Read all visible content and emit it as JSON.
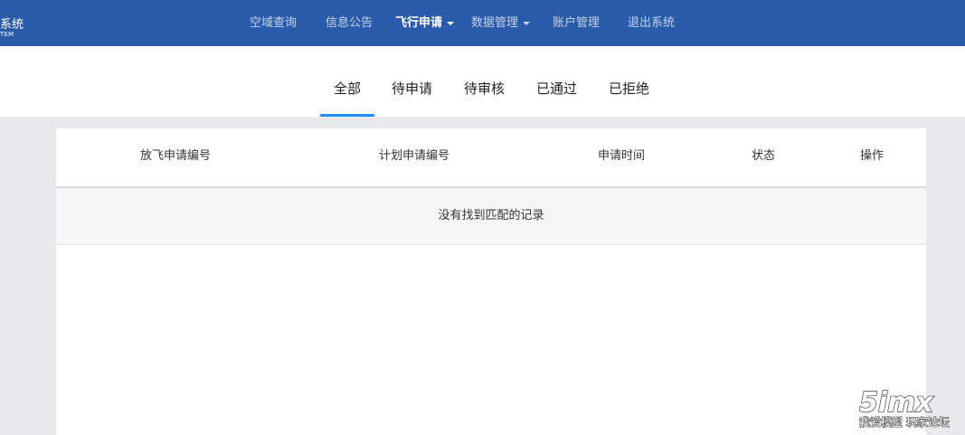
{
  "brand": {
    "title": "系统",
    "subtitle": "TEM"
  },
  "nav": {
    "items": [
      {
        "label": "空域查询"
      },
      {
        "label": "信息公告"
      },
      {
        "label": "飞行申请"
      },
      {
        "label": "数据管理"
      },
      {
        "label": "账户管理"
      },
      {
        "label": "退出系统"
      }
    ],
    "active_index": 2
  },
  "tabs": {
    "items": [
      {
        "label": "全部"
      },
      {
        "label": "待申请"
      },
      {
        "label": "待审核"
      },
      {
        "label": "已通过"
      },
      {
        "label": "已拒绝"
      }
    ],
    "active_index": 0
  },
  "table": {
    "columns": [
      "放飞申请编号",
      "计划申请编号",
      "申请时间",
      "状态",
      "操作"
    ],
    "empty_text": "没有找到匹配的记录"
  },
  "watermark": {
    "line1": "5imx",
    "line2": "我爱模型 玩家论坛"
  },
  "colors": {
    "nav_bg": "#2b5cab",
    "tab_active_underline": "#1e90ff",
    "page_bg": "#e8e9ea"
  }
}
